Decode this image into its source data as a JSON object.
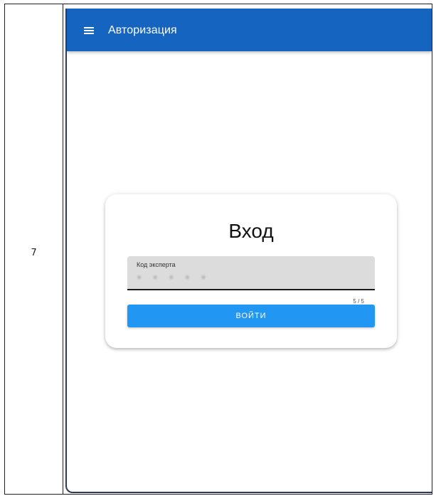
{
  "row": {
    "number": "7"
  },
  "app_bar": {
    "title": "Авторизация",
    "menu_icon": "hamburger-menu-icon"
  },
  "login": {
    "title": "Вход",
    "field": {
      "label": "Код эксперта",
      "value": "● ● ● ● ●",
      "counter": "5 / 5"
    },
    "submit_label": "ВОЙТИ"
  },
  "colors": {
    "app_bar": "#1565c0",
    "button": "#2196f3",
    "field_background": "#dcdcdc"
  }
}
